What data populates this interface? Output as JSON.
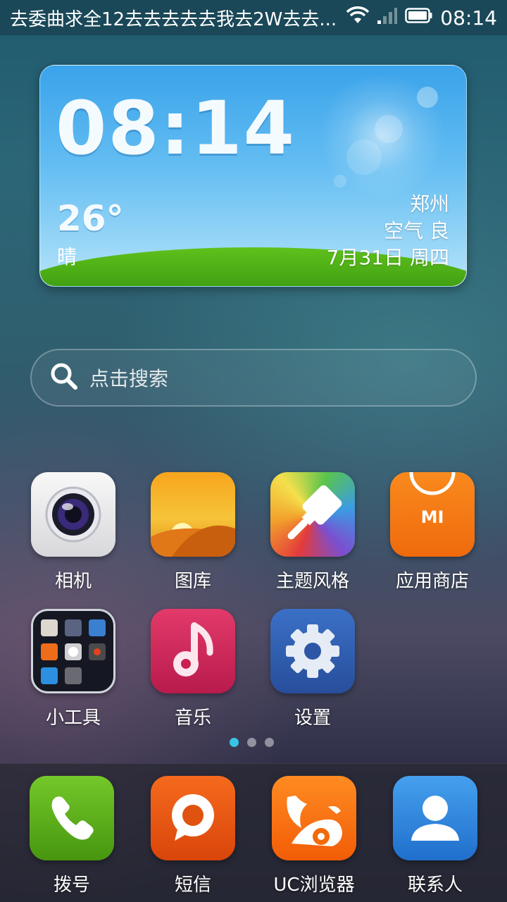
{
  "status_bar": {
    "notification": "去委曲求全12去去去去去我去2W去去...",
    "time": "08:14",
    "icons": [
      "wifi-icon",
      "signal-icon",
      "battery-icon"
    ]
  },
  "weather_widget": {
    "clock": "08:14",
    "temperature": "26°",
    "condition": "晴",
    "city": "郑州",
    "air_quality": "空气 良",
    "date": "7月31日 周四"
  },
  "search": {
    "placeholder": "点击搜索",
    "icon": "search-icon"
  },
  "apps": [
    {
      "label": "相机",
      "icon": "camera-icon"
    },
    {
      "label": "图库",
      "icon": "gallery-icon"
    },
    {
      "label": "主题风格",
      "icon": "theme-brush-icon"
    },
    {
      "label": "应用商店",
      "icon": "mi-store-icon",
      "icon_text": "MI"
    },
    {
      "label": "小工具",
      "icon": "tools-folder-icon"
    },
    {
      "label": "音乐",
      "icon": "music-note-icon"
    },
    {
      "label": "设置",
      "icon": "settings-gear-icon"
    }
  ],
  "page_indicator": {
    "count": 3,
    "active": 0
  },
  "dock": [
    {
      "label": "拨号",
      "icon": "phone-icon"
    },
    {
      "label": "短信",
      "icon": "sms-icon"
    },
    {
      "label": "UC浏览器",
      "icon": "uc-browser-icon"
    },
    {
      "label": "联系人",
      "icon": "contacts-icon"
    }
  ],
  "colors": {
    "accent_dot": "#38c3e6",
    "status_bar": "#1a4656"
  }
}
